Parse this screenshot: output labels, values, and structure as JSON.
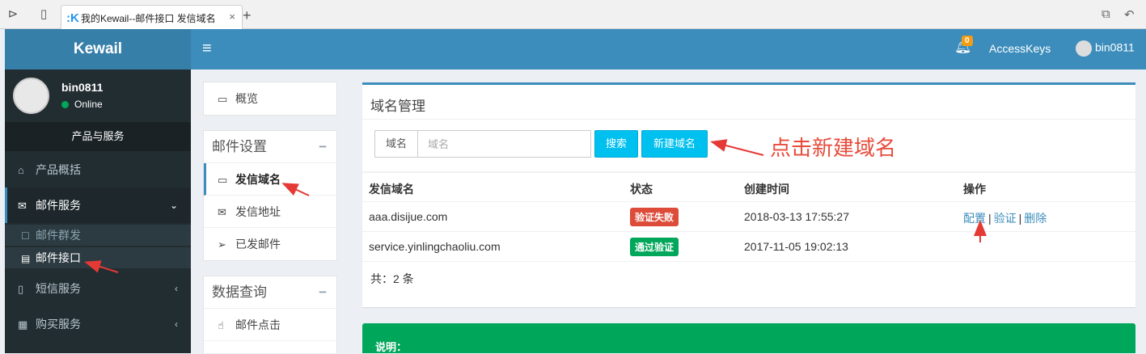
{
  "browser": {
    "tab_title": "我的Kewail--邮件接口 发信域名",
    "favicon": "k-favicon",
    "close_glyph": "×",
    "newtab_glyph": "+"
  },
  "header": {
    "logo": "Kewail",
    "menu_glyph": "≡",
    "bell_badge": "0",
    "access_keys": "AccessKeys",
    "user": "bin0811"
  },
  "sidebar": {
    "user_name": "bin0811",
    "status": "Online",
    "section_header": "产品与服务",
    "items": [
      {
        "label": "产品概括",
        "icon": "home-icon"
      },
      {
        "label": "邮件服务",
        "icon": "envelope-icon",
        "caret": "⌄"
      },
      {
        "label": "短信服务",
        "icon": "mobile-icon",
        "caret": "‹"
      },
      {
        "label": "购买服务",
        "icon": "grid-icon",
        "caret": "‹"
      }
    ],
    "subitems": [
      {
        "label": "邮件群发"
      },
      {
        "label": "邮件接口"
      }
    ]
  },
  "midmenu": {
    "overview": "概览",
    "mail_settings_title": "邮件设置",
    "mail_settings_items": [
      "发信域名",
      "发信地址",
      "已发邮件"
    ],
    "data_query_title": "数据查询",
    "data_query_items": [
      "邮件点击"
    ],
    "collapse_glyph": "−"
  },
  "main": {
    "title": "域名管理",
    "search_label": "域名",
    "search_placeholder": "域名",
    "search_button": "搜索",
    "new_domain_button": "新建域名",
    "columns": [
      "发信域名",
      "状态",
      "创建时间",
      "操作"
    ],
    "rows": [
      {
        "domain": "aaa.disijue.com",
        "status": "验证失败",
        "created": "2018-03-13 17:55:27",
        "actions": [
          "配置",
          "验证",
          "删除"
        ]
      },
      {
        "domain": "service.yinlingchaoliu.com",
        "status": "通过验证",
        "created": "2017-11-05 19:02:13",
        "actions": []
      }
    ],
    "total": "共：2 条"
  },
  "notice": {
    "title": "说明："
  },
  "annotation": {
    "text": "点击新建域名"
  },
  "colors": {
    "brand": "#3c8dbc",
    "sidebar": "#222d32",
    "info_button": "#00c0ef",
    "danger": "#dd4b39",
    "success": "#00a65a",
    "annotation_red": "#e74c3c"
  }
}
